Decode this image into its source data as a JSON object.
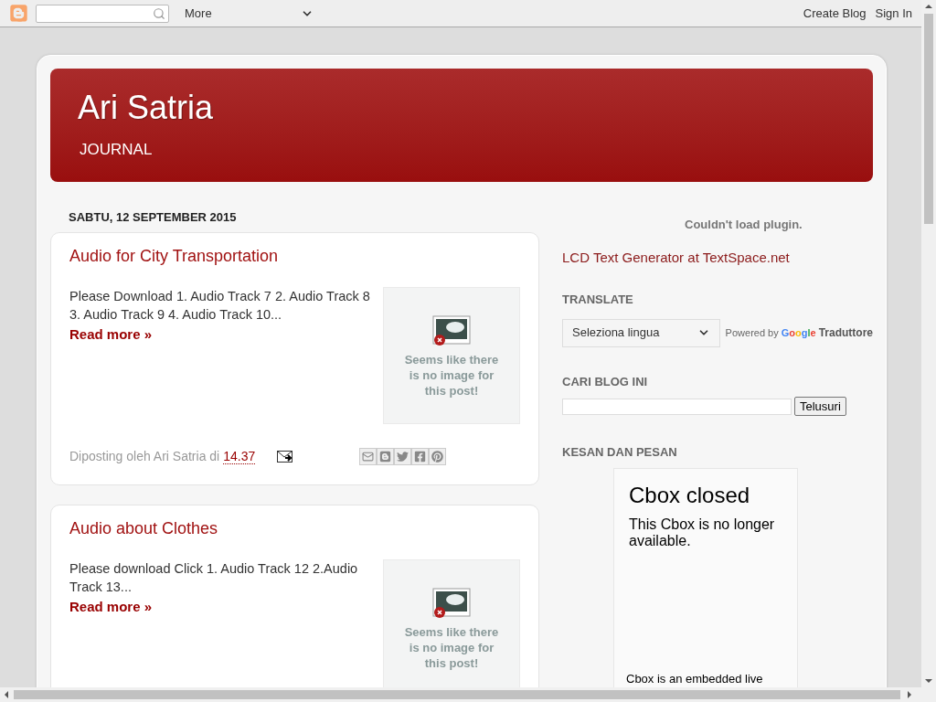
{
  "navbar": {
    "more": "More",
    "links": [
      "Create Blog",
      "Sign In"
    ]
  },
  "header": {
    "title": "Ari Satria",
    "subtitle": "JOURNAL"
  },
  "date_header": "SABTU, 12 SEPTEMBER 2015",
  "posts": [
    {
      "title": "Audio for City Transportation",
      "snippet": "Please Download 1. Audio Track 7 2. Audio Track 8 3. Audio Track 9 4. Audio Track 10...",
      "read_more": "Read more »",
      "thumbnail_text": "Seems like there is no image for this post!",
      "byline": "Diposting oleh Ari Satria di",
      "time": "14.37"
    },
    {
      "title": "Audio about Clothes",
      "snippet": "Please download Click 1. Audio Track 12 2.Audio Track 13...",
      "read_more": "Read more »",
      "thumbnail_text": "Seems like there is no image for this post!"
    }
  ],
  "sidebar": {
    "plugin_error": "Couldn't load plugin.",
    "lcd_link": "LCD Text Generator at TextSpace.net",
    "translate": {
      "heading": "TRANSLATE",
      "select": "Seleziona lingua",
      "powered_by": "Powered by",
      "google": "Google",
      "product": "Traduttore"
    },
    "search": {
      "heading": "CARI BLOG INI",
      "button": "Telusuri"
    },
    "guestbook": {
      "heading": "KESAN DAN PESAN",
      "title": "Cbox closed",
      "message": "This Cbox is no longer available.",
      "footer": "Cbox is an embedded live"
    }
  }
}
